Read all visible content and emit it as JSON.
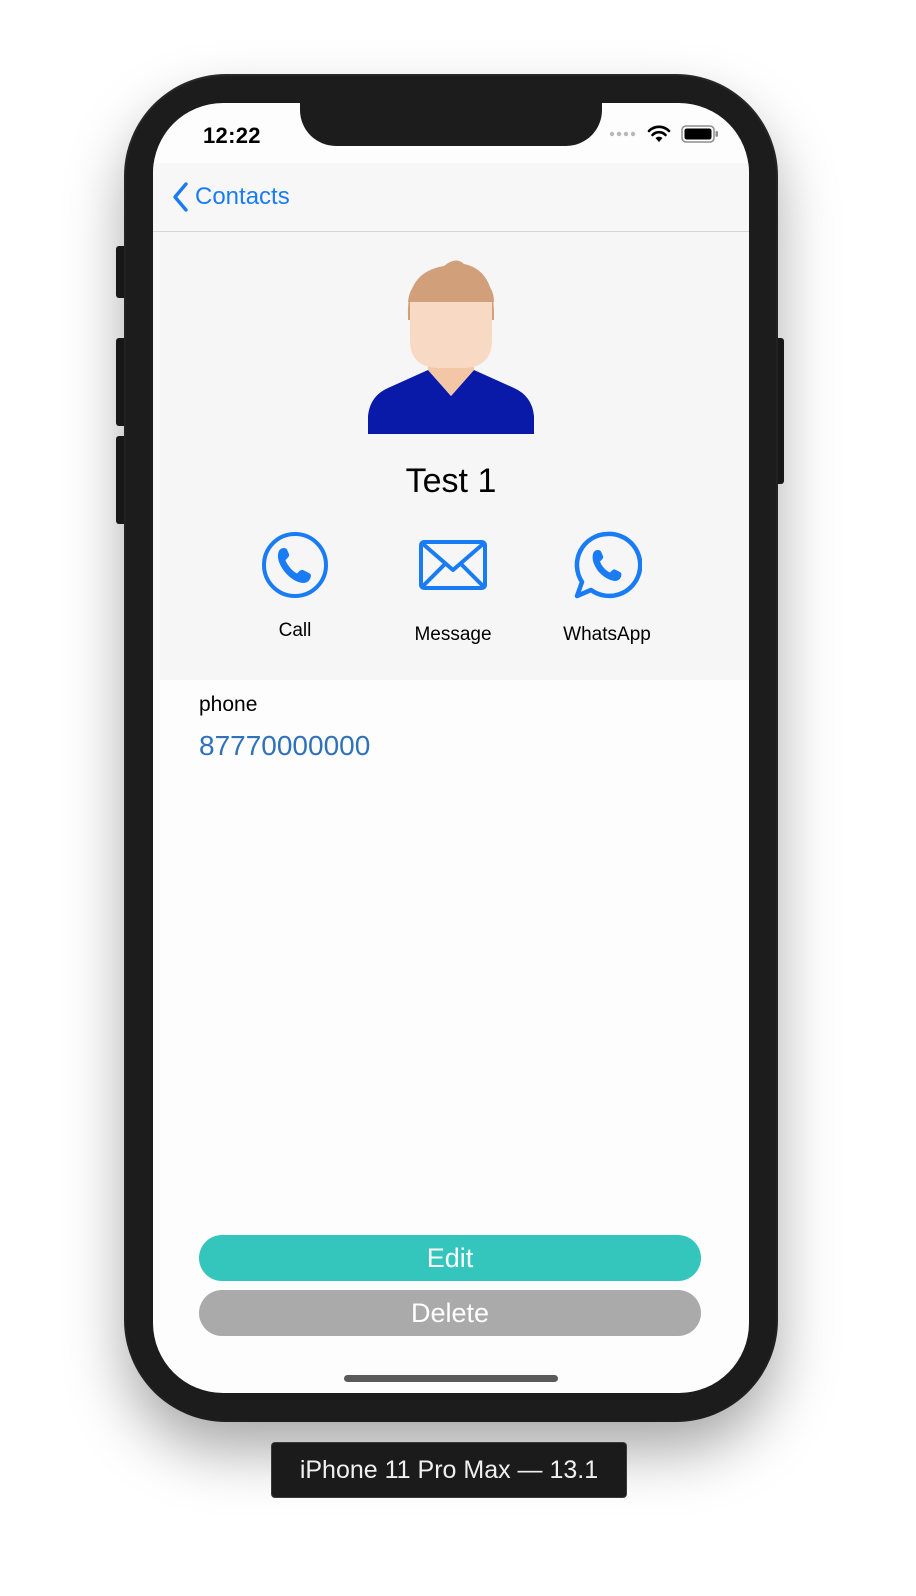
{
  "status_bar": {
    "time": "12:22",
    "icons": [
      "signal-dots-icon",
      "wifi-icon",
      "battery-icon"
    ]
  },
  "nav": {
    "back_label": "Contacts",
    "back_icon": "chevron-left-icon"
  },
  "contact": {
    "avatar_icon": "person-avatar-icon",
    "name": "Test 1"
  },
  "actions": [
    {
      "label": "Call",
      "icon": "phone-icon"
    },
    {
      "label": "Message",
      "icon": "envelope-icon"
    },
    {
      "label": "WhatsApp",
      "icon": "whatsapp-icon"
    }
  ],
  "details": {
    "phone_label": "phone",
    "phone_value": "87770000000"
  },
  "buttons": {
    "edit_label": "Edit",
    "delete_label": "Delete"
  },
  "device_label": "iPhone 11 Pro Max — 13.1",
  "colors": {
    "accent": "#1a7cf5",
    "link": "#3072b9",
    "edit_button": "#34c6bd",
    "delete_button": "#aaaaaa",
    "avatar_shirt": "#0a1aa8",
    "avatar_hair": "#d1a07a",
    "avatar_skin": "#f8d9c4"
  }
}
